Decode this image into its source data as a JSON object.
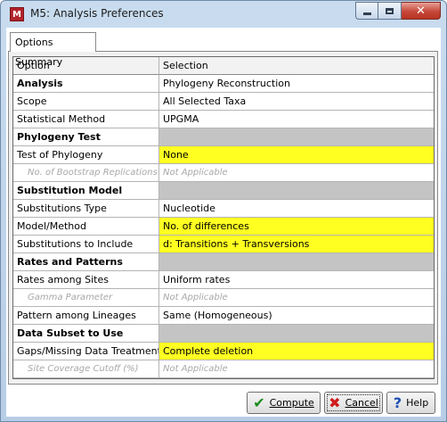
{
  "window": {
    "title": "M5: Analysis Preferences",
    "app_icon_label": "M"
  },
  "tab": {
    "label": "Options Summary"
  },
  "table": {
    "columns": [
      "Option",
      "Selection"
    ],
    "rows": [
      {
        "option": "Analysis",
        "selection": "Phylogeny Reconstruction",
        "kind": "section"
      },
      {
        "option": "Scope",
        "selection": "All Selected Taxa",
        "kind": "normal"
      },
      {
        "option": "Statistical Method",
        "selection": "UPGMA",
        "kind": "normal"
      },
      {
        "option": "Phylogeny Test",
        "selection": "",
        "kind": "section-gray"
      },
      {
        "option": "Test of Phylogeny",
        "selection": "None",
        "kind": "editable"
      },
      {
        "option": "No. of Bootstrap Replications",
        "selection": "Not Applicable",
        "kind": "disabled"
      },
      {
        "option": "Substitution Model",
        "selection": "",
        "kind": "section-gray"
      },
      {
        "option": "Substitutions Type",
        "selection": "Nucleotide",
        "kind": "normal"
      },
      {
        "option": "Model/Method",
        "selection": "No. of differences",
        "kind": "editable"
      },
      {
        "option": "Substitutions to Include",
        "selection": "d: Transitions + Transversions",
        "kind": "editable"
      },
      {
        "option": "Rates and Patterns",
        "selection": "",
        "kind": "section-gray"
      },
      {
        "option": "Rates among Sites",
        "selection": "Uniform rates",
        "kind": "normal"
      },
      {
        "option": "Gamma Parameter",
        "selection": "Not Applicable",
        "kind": "disabled"
      },
      {
        "option": "Pattern among Lineages",
        "selection": "Same (Homogeneous)",
        "kind": "normal"
      },
      {
        "option": "Data Subset to Use",
        "selection": "",
        "kind": "section-gray"
      },
      {
        "option": "Gaps/Missing Data Treatment",
        "selection": "Complete deletion",
        "kind": "editable"
      },
      {
        "option": "Site Coverage Cutoff (%)",
        "selection": "Not Applicable",
        "kind": "disabled"
      }
    ]
  },
  "buttons": {
    "compute": "Compute",
    "cancel": "Cancel",
    "help": "Help"
  },
  "colors": {
    "highlight": "#ffff22",
    "section_gray": "#c4c4c4"
  }
}
